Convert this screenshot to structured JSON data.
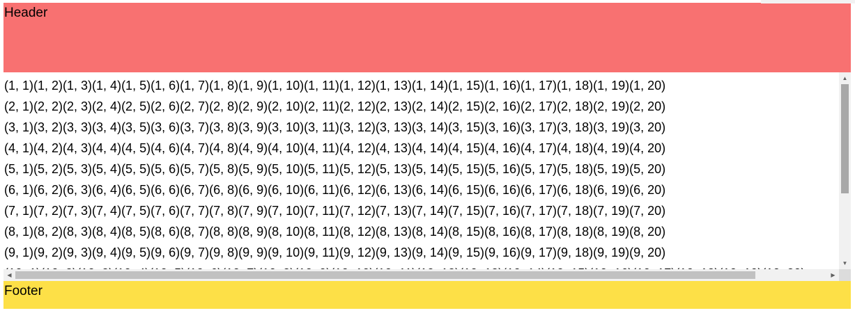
{
  "header": {
    "label": "Header"
  },
  "footer": {
    "label": "Footer"
  },
  "grid": {
    "rows": 10,
    "cols": 20,
    "format": "(row, col)"
  },
  "colors": {
    "header_bg": "#f87171",
    "footer_bg": "#fde047",
    "scrollbar_track": "#f1f1f1",
    "scrollbar_thumb": "#a8a8a8"
  },
  "scroll": {
    "vertical_position": 0,
    "horizontal_position": 0
  }
}
